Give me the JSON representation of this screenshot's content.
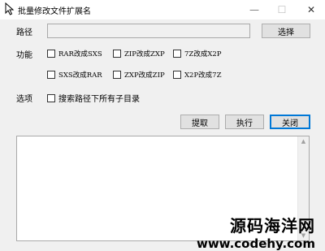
{
  "window": {
    "title": "批量修改文件扩展名",
    "icon": "app-cursor-icon",
    "controls": {
      "minimize": "—",
      "maximize": "☐",
      "close": "✕"
    }
  },
  "path_row": {
    "label": "路径",
    "value": "",
    "browse_label": "选择"
  },
  "function": {
    "label": "功能",
    "options": [
      {
        "label": "RAR改成SXS",
        "checked": false
      },
      {
        "label": "ZIP改成ZXP",
        "checked": false
      },
      {
        "label": "7Z改成X2P",
        "checked": false
      },
      {
        "label": "SXS改成RAR",
        "checked": false
      },
      {
        "label": "ZXP改成ZIP",
        "checked": false
      },
      {
        "label": "X2P改成7Z",
        "checked": false
      }
    ]
  },
  "options": {
    "label": "选项",
    "recurse": {
      "label": "搜索路径下所有子目录",
      "checked": false
    }
  },
  "actions": {
    "extract": "提取",
    "run": "执行",
    "close": "关闭"
  },
  "log": {
    "text": "",
    "scroll_up": "▲",
    "scroll_down": "▼"
  },
  "watermark": {
    "site_name": "源码海洋网",
    "url": "www.codehy.com"
  }
}
